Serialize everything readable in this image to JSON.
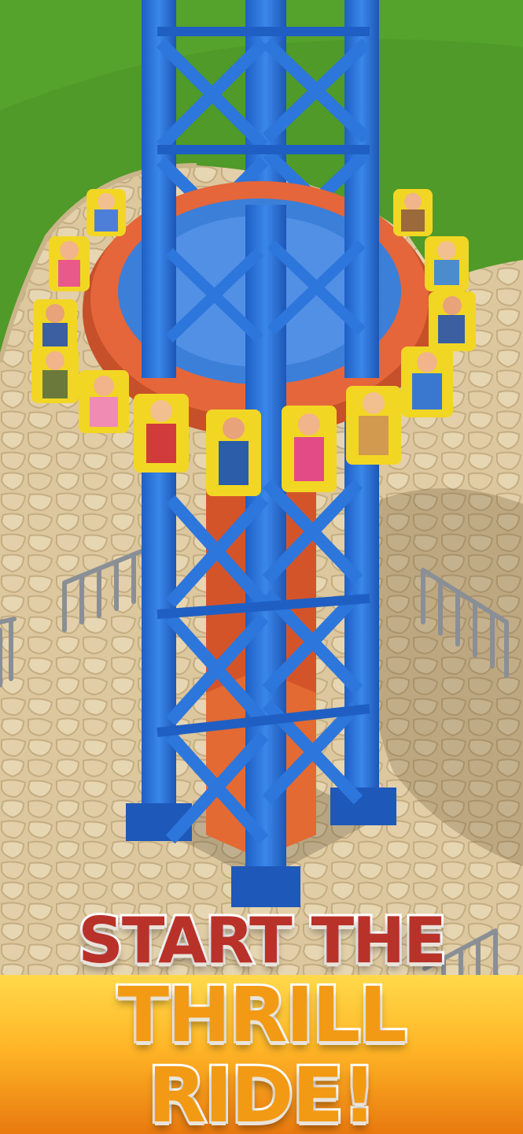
{
  "promo": {
    "line1": "START THE",
    "line2": "THRILL RIDE!"
  },
  "colors": {
    "grass": "#4f9a28",
    "pavement": "#d9c39a",
    "tower": "#2c73d8",
    "ring": "#e0622c",
    "seat": "#f2d624",
    "headline_red": "#b8322a",
    "headline_orange": "#f29a14"
  },
  "icons": [
    "drop-tower",
    "control-panel",
    "fence"
  ]
}
